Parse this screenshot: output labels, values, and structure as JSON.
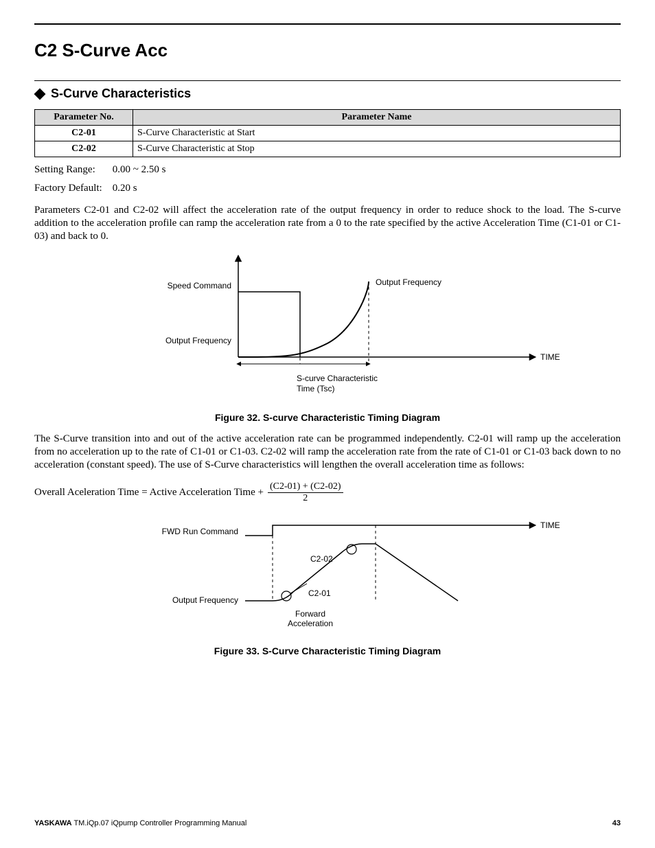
{
  "heading": "C2 S-Curve Acc",
  "subheading": "S-Curve Characteristics",
  "table": {
    "headers": [
      "Parameter No.",
      "Parameter Name"
    ],
    "rows": [
      {
        "no": "C2-01",
        "name": "S-Curve Characteristic at Start"
      },
      {
        "no": "C2-02",
        "name": "S-Curve Characteristic at Stop"
      }
    ]
  },
  "setting_range": {
    "label": "Setting Range:",
    "value": "0.00 ~ 2.50 s"
  },
  "factory_default": {
    "label": "Factory Default:",
    "value": "0.20 s"
  },
  "para1": "Parameters C2-01 and C2-02 will affect the acceleration rate of the output frequency in order to reduce shock to the load. The S-curve addition to the acceleration profile can ramp the acceleration rate from a 0 to the rate specified by the active Acceleration Time (C1-01 or C1-03) and back to 0.",
  "fig32": {
    "caption": "Figure 32.  S-curve Characteristic Timing Diagram",
    "labels": {
      "speed_command": "Speed Command",
      "output_frequency_left": "Output Frequency",
      "output_frequency_top": "Output Frequency",
      "time": "TIME",
      "s_curve_l1": "S-curve Characteristic",
      "s_curve_l2": "Time (Tsc)"
    }
  },
  "para2": "The S-Curve transition into and out of the active acceleration rate can be programmed independently. C2-01 will ramp up the acceleration from no acceleration up to the rate of C1-01 or C1-03. C2-02 will ramp the acceleration rate from the rate of C1-01 or C1-03 back down to no acceleration (constant speed). The use of S-Curve characteristics will lengthen the overall acceleration time as follows:",
  "formula": {
    "lhs": "Overall Aceleration Time  =  Active Acceleration Time + ",
    "num": "(C2-01) + (C2-02)",
    "den": "2"
  },
  "fig33": {
    "caption": "Figure 33.  S-Curve Characteristic Timing Diagram",
    "labels": {
      "fwd_run": "FWD Run Command",
      "output_frequency": "Output Frequency",
      "time": "TIME",
      "c2_02": "C2-02",
      "c2_01": "C2-01",
      "fwd_l1": "Forward",
      "fwd_l2": "Acceleration"
    }
  },
  "footer": {
    "brand": "YASKAWA",
    "doc": " TM.iQp.07 iQpump Controller Programming Manual",
    "page": "43"
  }
}
